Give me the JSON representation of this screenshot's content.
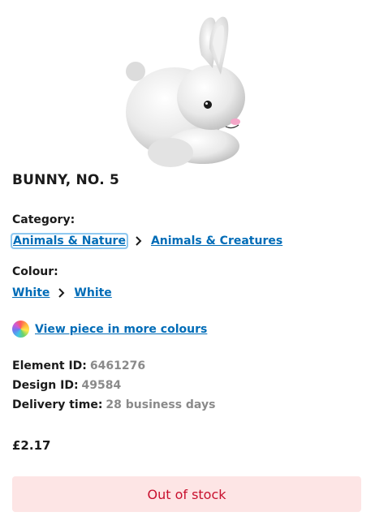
{
  "product": {
    "title": "BUNNY, NO. 5",
    "image_icon": "bunny-figure"
  },
  "category": {
    "label": "Category:",
    "items": [
      "Animals & Nature",
      "Animals & Creatures"
    ]
  },
  "colour": {
    "label": "Colour:",
    "items": [
      "White",
      "White"
    ]
  },
  "more_colours": {
    "link_text": "View piece in more colours",
    "icon": "colour-wheel-icon"
  },
  "details": {
    "element_id_label": "Element ID:",
    "element_id": "6461276",
    "design_id_label": "Design ID:",
    "design_id": "49584",
    "delivery_label": "Delivery time:",
    "delivery": "28 business days"
  },
  "price": "£2.17",
  "stock_button": "Out of stock",
  "colors": {
    "link": "#006cb7",
    "out_of_stock_bg": "#fde5e5",
    "out_of_stock_text": "#c8102e"
  }
}
